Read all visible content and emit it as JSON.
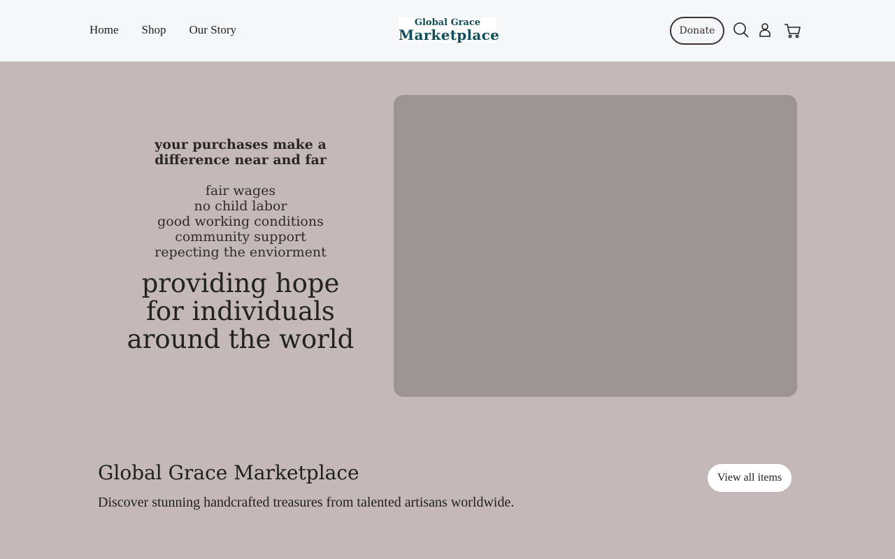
{
  "header": {
    "nav": [
      "Home",
      "Shop",
      "Our Story"
    ],
    "logo": {
      "line1": "Global Grace",
      "line2": "Marketplace"
    },
    "donate_label": "Donate",
    "icons": [
      "search-icon",
      "account-icon",
      "cart-icon"
    ]
  },
  "hero": {
    "tagline": "your purchases make a difference near and far",
    "values": [
      "fair wages",
      "no child labor",
      "good working conditions",
      "community support",
      "repecting the enviorment"
    ],
    "headline": "providing hope for individuals around the world"
  },
  "section": {
    "title": "Global Grace Marketplace",
    "subtitle": "Discover stunning handcrafted treasures from talented artisans worldwide.",
    "view_all_label": "View all items"
  },
  "colors": {
    "page_background": "#c4b8b8",
    "header_background": "#f4f6f8",
    "image_placeholder": "#9c9392",
    "logo_text": "#0f4f5a",
    "button_border": "#3b3033"
  }
}
